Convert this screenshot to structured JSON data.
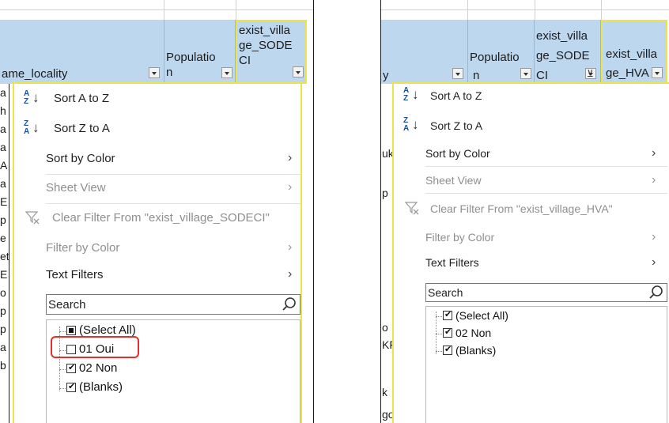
{
  "left_panel": {
    "headers": {
      "name_locality": "ame_locality",
      "population": [
        "Populatio",
        "n"
      ],
      "exist_sodeci": [
        "exist_villa",
        "ge_SODE",
        "CI"
      ]
    },
    "row_fragments": [
      "a",
      "h",
      "a",
      "a",
      "A",
      "a",
      "E",
      "p",
      "e",
      "et",
      "E",
      "o",
      "p",
      "p",
      "a",
      "b"
    ],
    "menu": {
      "sort_az": "Sort A to Z",
      "sort_za": "Sort Z to A",
      "sort_by_color": "Sort by Color",
      "sheet_view": "Sheet View",
      "clear_filter": "Clear Filter From \"exist_village_SODECI\"",
      "filter_by_color": "Filter by Color",
      "text_filters": "Text Filters",
      "search_placeholder": "Search",
      "items": [
        {
          "label": "(Select All)",
          "state": "indeterminate"
        },
        {
          "label": "01 Oui",
          "state": "unchecked"
        },
        {
          "label": "02 Non",
          "state": "checked"
        },
        {
          "label": "(Blanks)",
          "state": "checked"
        }
      ]
    }
  },
  "right_panel": {
    "headers": {
      "name_locality": "y",
      "population": [
        "Populatio",
        "n"
      ],
      "exist_sodeci": [
        "exist_villa",
        "ge_SODE",
        "CI"
      ],
      "exist_hva": [
        "exist_villa",
        "ge_HVA"
      ]
    },
    "row_fragments": [
      "uk",
      "p",
      "o",
      "KR",
      "k",
      "go"
    ],
    "menu": {
      "sort_az": "Sort A to Z",
      "sort_za": "Sort Z to A",
      "sort_by_color": "Sort by Color",
      "sheet_view": "Sheet View",
      "clear_filter": "Clear Filter From \"exist_village_HVA\"",
      "filter_by_color": "Filter by Color",
      "text_filters": "Text Filters",
      "search_placeholder": "Search",
      "items": [
        {
          "label": "(Select All)",
          "state": "checked"
        },
        {
          "label": "02 Non",
          "state": "checked"
        },
        {
          "label": "(Blanks)",
          "state": "checked"
        }
      ]
    }
  },
  "colors": {
    "header_fill": "#bdd7ee",
    "highlight_yellow": "#ebe54a",
    "highlight_red": "#e03030"
  },
  "icons": {
    "sort_az": "sort-ascending-icon",
    "sort_za": "sort-descending-icon",
    "chevron": "chevron-right-icon",
    "clear_filter": "clear-filter-icon",
    "search": "search-icon",
    "dropdown": "dropdown-arrow-icon"
  }
}
